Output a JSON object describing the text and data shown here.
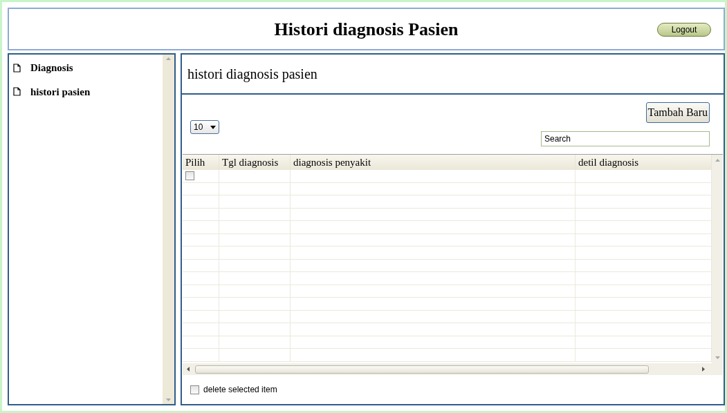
{
  "header": {
    "title": "Histori diagnosis Pasien",
    "logout_button": "Logout"
  },
  "sidebar": {
    "items": [
      {
        "label": "Diagnosis"
      },
      {
        "label": "histori pasien"
      }
    ]
  },
  "main": {
    "title": "histori diagnosis pasien",
    "page_size": "10",
    "add_button": "Tambah Baru",
    "search": {
      "value": "Search"
    },
    "table": {
      "columns": [
        "Pilih",
        "Tgl diagnosis",
        "diagnosis penyakit",
        "detil diagnosis"
      ],
      "rows": [
        {
          "checked": false
        }
      ]
    },
    "delete_option": {
      "label": "delete selected item",
      "checked": false
    }
  }
}
